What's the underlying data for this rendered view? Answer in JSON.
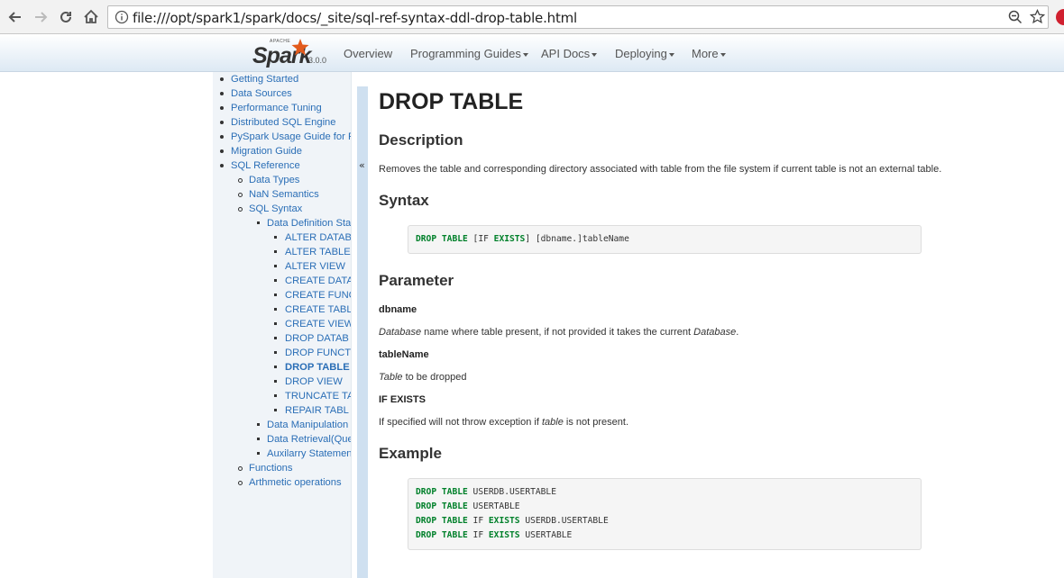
{
  "browser": {
    "url": "file:///opt/spark1/spark/docs/_site/sql-ref-syntax-ddl-drop-table.html"
  },
  "navbar": {
    "logo_apache": "APACHE",
    "logo_word": "Spark",
    "version": "3.0.0",
    "items": [
      "Overview",
      "Programming Guides",
      "API Docs",
      "Deploying",
      "More"
    ]
  },
  "sidebar": {
    "items": [
      "Getting Started",
      "Data Sources",
      "Performance Tuning",
      "Distributed SQL Engine",
      "PySpark Usage Guide for P",
      "Migration Guide",
      "SQL Reference",
      "Data Types",
      "NaN Semantics",
      "SQL Syntax",
      "Data Definition Sta",
      "ALTER DATAB",
      "ALTER TABLE",
      "ALTER VIEW",
      "CREATE DATA",
      "CREATE FUNC",
      "CREATE TABL",
      "CREATE VIEW",
      "DROP DATAB",
      "DROP FUNCT",
      "DROP TABLE",
      "DROP VIEW",
      "TRUNCATE TA",
      "REPAIR TABL",
      "Data Manipulation",
      "Data Retrieval(Que",
      "Auxilarry Statemen",
      "Functions",
      "Arthmetic operations"
    ],
    "collapse_glyph": "«"
  },
  "content": {
    "title": "DROP TABLE",
    "description_heading": "Description",
    "description_text": "Removes the table and corresponding directory associated with table from the file system if current table is not an external table.",
    "syntax_heading": "Syntax",
    "syntax": {
      "kw1": "DROP",
      "kw2": "TABLE",
      "p1": " [IF ",
      "kw3": "EXISTS",
      "p2": "] [dbname.]tableName"
    },
    "parameter_heading": "Parameter",
    "params": [
      {
        "name": "dbname",
        "em1": "Database",
        "text": " name where table present, if not provided it takes the current ",
        "em2": "Database",
        "tail": "."
      },
      {
        "name": "tableName",
        "em1": "Table",
        "text": " to be dropped"
      },
      {
        "name": "IF EXISTS",
        "text": "If specified will not throw exception if ",
        "em1": "table",
        "tail": " is not present."
      }
    ],
    "example_heading": "Example",
    "example": [
      {
        "kw1": "DROP",
        "kw2": "TABLE",
        "mid": "",
        "kw3": "",
        "rest": " USERDB.USERTABLE"
      },
      {
        "kw1": "DROP",
        "kw2": "TABLE",
        "mid": "",
        "kw3": "",
        "rest": " USERTABLE"
      },
      {
        "kw1": "DROP",
        "kw2": "TABLE",
        "mid": " IF ",
        "kw3": "EXISTS",
        "rest": " USERDB.USERTABLE"
      },
      {
        "kw1": "DROP",
        "kw2": "TABLE",
        "mid": " IF ",
        "kw3": "EXISTS",
        "rest": " USERTABLE"
      }
    ]
  }
}
